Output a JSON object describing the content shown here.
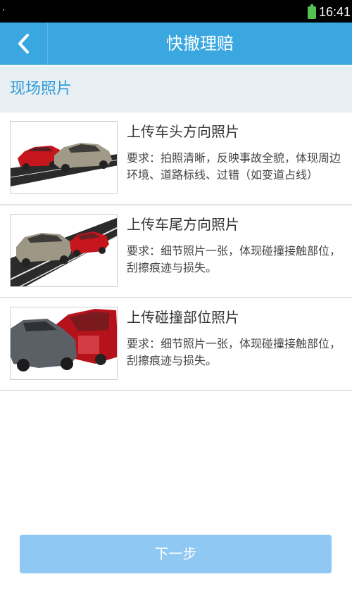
{
  "status_bar": {
    "time": "16:41",
    "battery_icon": "battery-icon"
  },
  "app_bar": {
    "title": "快撤理赔",
    "back_icon": "chevron-left-icon"
  },
  "section": {
    "title": "现场照片"
  },
  "items": [
    {
      "title": "上传车头方向照片",
      "description": "要求：拍照清晰，反映事故全貌，体现周边环境、道路标线、过错（如变道占线）",
      "thumbnail": "front-collision-photo"
    },
    {
      "title": "上传车尾方向照片",
      "description": "要求：细节照片一张，体现碰撞接触部位，刮擦痕迹与损失。",
      "thumbnail": "rear-collision-photo"
    },
    {
      "title": "上传碰撞部位照片",
      "description": "要求：细节照片一张，体现碰撞接触部位，刮擦痕迹与损失。",
      "thumbnail": "impact-detail-photo"
    }
  ],
  "footer": {
    "next_label": "下一步"
  },
  "colors": {
    "primary": "#3aa7e0",
    "section_bg": "#e7eff3",
    "button_disabled": "#8fc8f2"
  }
}
